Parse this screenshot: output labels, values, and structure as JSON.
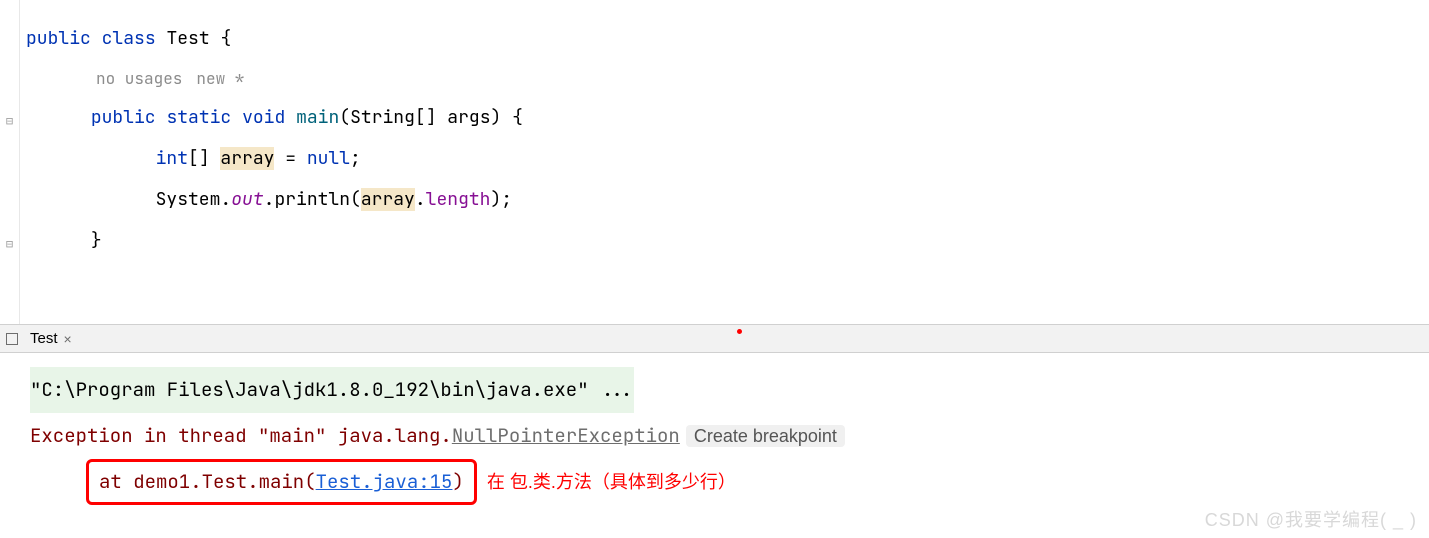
{
  "editor": {
    "hints": {
      "usages": "no usages",
      "vcs": "new *"
    },
    "code": {
      "l1": {
        "kw1": "public",
        "kw2": "class",
        "name": "Test",
        "brace": " {"
      },
      "l3": {
        "kw1": "public",
        "kw2": "static",
        "kw3": "void",
        "method": "main",
        "params_open": "(",
        "param_type": "String[] ",
        "param_name": "args",
        "params_close": ")",
        "brace": " {"
      },
      "l4": {
        "type": "int",
        "brackets": "[] ",
        "var": "array",
        "assign": " = ",
        "null": "null",
        "semi": ";"
      },
      "l5": {
        "obj": "System.",
        "field": "out",
        "dot": ".",
        "method": "println",
        "open": "(",
        "arg": "array",
        "dot2": ".",
        "prop": "length",
        "close": ")",
        "semi": ";"
      },
      "l6": {
        "brace": "}"
      }
    }
  },
  "tab": {
    "name": "Test"
  },
  "console": {
    "cmd": "\"C:\\Program Files\\Java\\jdk1.8.0_192\\bin\\java.exe\" ...",
    "exception_prefix": "Exception in thread \"main\" java.lang.",
    "exception_class": "NullPointerException",
    "breakpoint_btn": "Create breakpoint",
    "stack": {
      "at": "at ",
      "loc": "demo1.Test.main",
      "open": "(",
      "file": "Test.java:15",
      "close": ")"
    }
  },
  "annotation": "在 包.类.方法（具体到多少行）",
  "watermark": "CSDN @我要学编程( _ )"
}
